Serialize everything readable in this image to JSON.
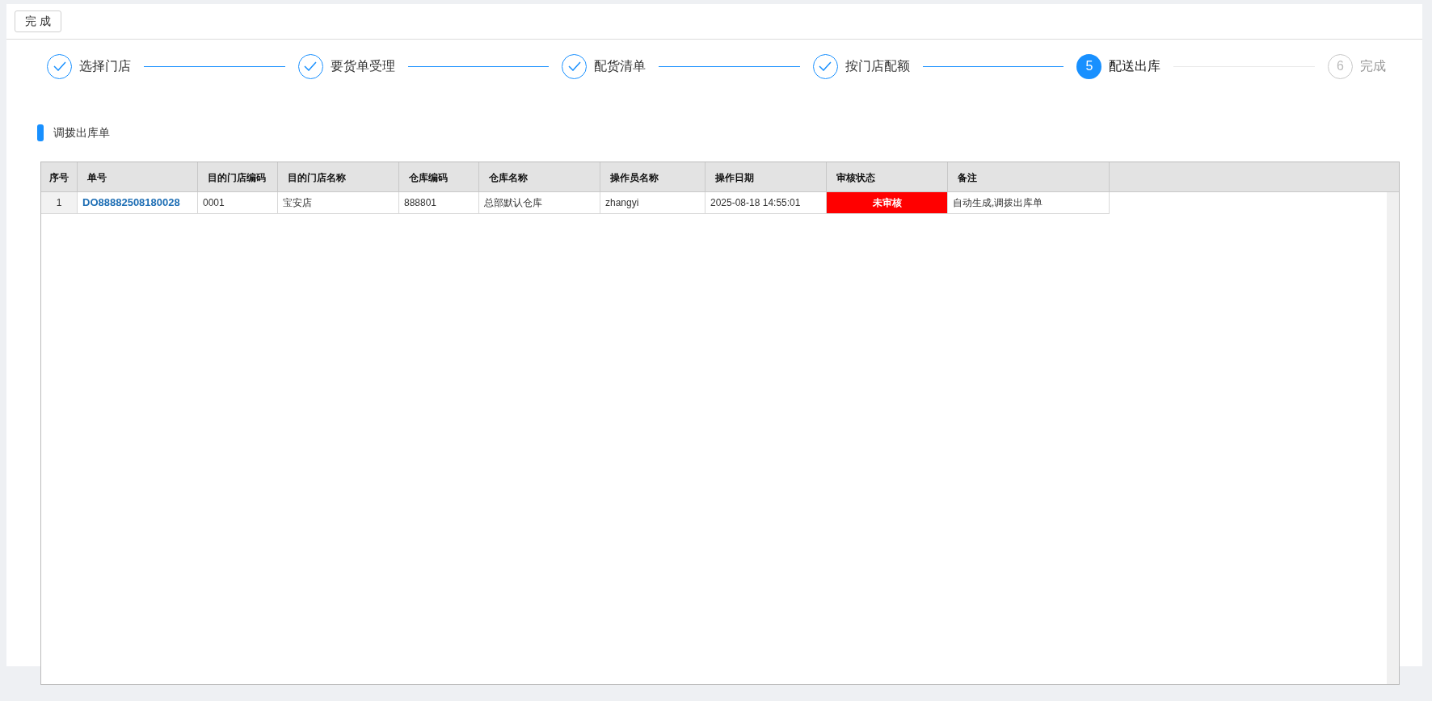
{
  "toolbar": {
    "done_button": "完 成"
  },
  "steps": [
    {
      "label": "选择门店",
      "done": true,
      "selected": false
    },
    {
      "label": "要货单受理",
      "done": true,
      "selected": false
    },
    {
      "label": "配货清单",
      "done": true,
      "selected": false
    },
    {
      "label": "按门店配额",
      "done": true,
      "selected": false
    },
    {
      "label": "配送出库",
      "done": false,
      "selected": true,
      "number": "5"
    },
    {
      "label": "完成",
      "done": false,
      "selected": false,
      "number": "6"
    }
  ],
  "section_title": "调拨出库单",
  "table": {
    "columns": [
      "序号",
      "单号",
      "目的门店编码",
      "目的门店名称",
      "仓库编码",
      "仓库名称",
      "操作员名称",
      "操作日期",
      "审核状态",
      "备注"
    ],
    "rows": [
      {
        "cells": [
          {
            "kind": "index",
            "text": "1"
          },
          {
            "kind": "link",
            "text": "DO88882508180028"
          },
          {
            "kind": "text",
            "text": "0001"
          },
          {
            "kind": "text",
            "text": "宝安店"
          },
          {
            "kind": "text",
            "text": "888801"
          },
          {
            "kind": "text",
            "text": "总部默认仓库"
          },
          {
            "kind": "text",
            "text": "zhangyi"
          },
          {
            "kind": "text",
            "text": "2025-08-18 14:55:01"
          },
          {
            "kind": "status",
            "text": "未审核",
            "approved": false
          },
          {
            "kind": "text",
            "text": "自动生成,调拨出库单"
          }
        ]
      }
    ]
  }
}
